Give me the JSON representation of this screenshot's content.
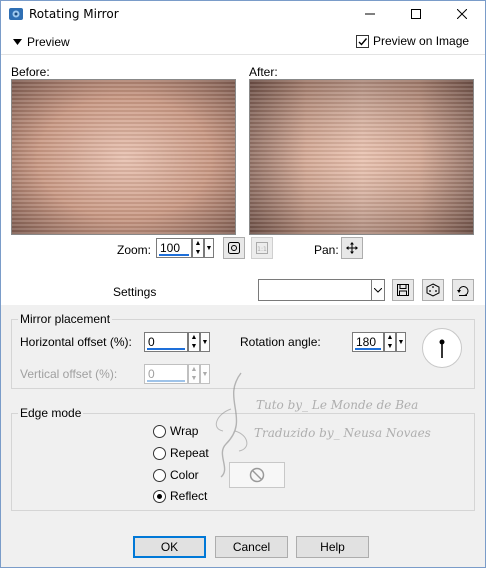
{
  "window": {
    "title": "Rotating Mirror",
    "controls": [
      "minimize",
      "maximize",
      "close"
    ]
  },
  "preview_bar": {
    "toggle_label": "Preview",
    "preview_on_image_label": "Preview on Image",
    "preview_on_image_checked": true
  },
  "preview": {
    "before_label": "Before:",
    "after_label": "After:",
    "zoom_label": "Zoom:",
    "zoom_value": "100",
    "pan_label": "Pan:"
  },
  "settings": {
    "label": "Settings",
    "value": ""
  },
  "mirror_placement": {
    "title": "Mirror placement",
    "horizontal_offset_label": "Horizontal offset (%):",
    "horizontal_offset_value": "0",
    "vertical_offset_label": "Vertical offset (%):",
    "vertical_offset_value": "0",
    "rotation_angle_label": "Rotation angle:",
    "rotation_angle_value": "180"
  },
  "edge_mode": {
    "title": "Edge mode",
    "options": [
      "Wrap",
      "Repeat",
      "Color",
      "Reflect"
    ],
    "selected": "Reflect"
  },
  "watermark": {
    "line1": "Tuto by_ Le Monde de Bea",
    "line2": "Traduzido by_ Neusa Novaes"
  },
  "buttons": {
    "ok": "OK",
    "cancel": "Cancel",
    "help": "Help"
  },
  "colors": {
    "accent": "#0078d7",
    "image_tone": "#c89a88"
  }
}
